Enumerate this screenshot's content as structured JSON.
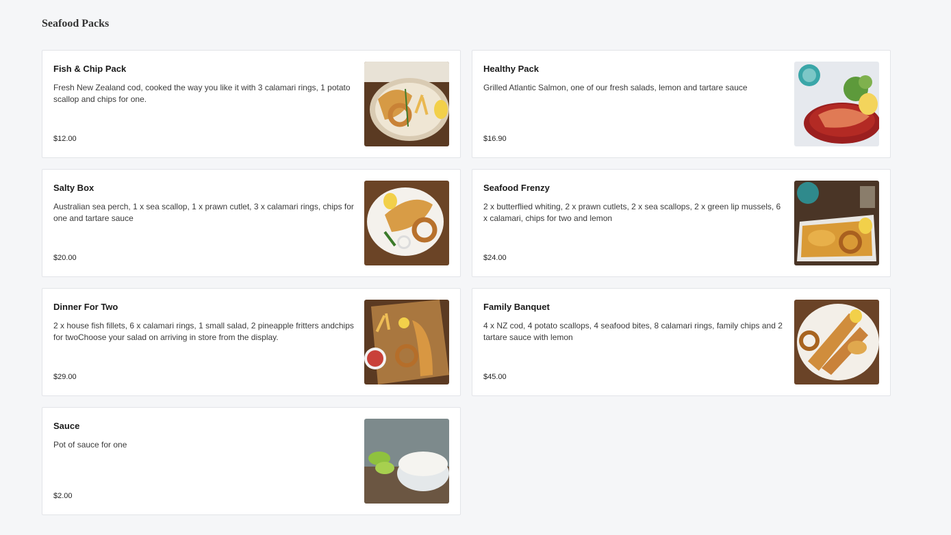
{
  "section": {
    "title": "Seafood Packs"
  },
  "items": [
    {
      "name": "Fish & Chip Pack",
      "description": "Fresh New Zealand cod, cooked the way you like it with 3 calamari rings, 1 potato scallop and chips for one.",
      "price": "$12.00",
      "image": "fish-and-chips"
    },
    {
      "name": "Healthy Pack",
      "description": "Grilled Atlantic Salmon, one of our fresh salads, lemon and tartare sauce",
      "price": "$16.90",
      "image": "salmon-salad"
    },
    {
      "name": "Salty Box",
      "description": "Australian sea perch, 1 x sea scallop, 1 x prawn cutlet, 3 x calamari rings, chips for one and tartare sauce",
      "price": "$20.00",
      "image": "fish-and-chips-plate"
    },
    {
      "name": "Seafood Frenzy",
      "description": "2 x butterflied whiting, 2 x prawn cutlets, 2 x sea scallops, 2 x green lip mussels, 6 x calamari, chips for two and lemon",
      "price": "$24.00",
      "image": "seafood-basket"
    },
    {
      "name": "Dinner For Two",
      "description": "2 x house fish fillets, 6 x calamari rings, 1 small salad, 2 pineapple fritters andchips for twoChoose your salad on arriving in store from the display.",
      "price": "$29.00",
      "image": "dinner-board"
    },
    {
      "name": "Family Banquet",
      "description": "4 x NZ cod, 4 potato scallops, 4 seafood bites, 8 calamari rings, family chips and 2 tartare sauce with lemon",
      "price": "$45.00",
      "image": "banquet-platter"
    },
    {
      "name": "Sauce",
      "description": "Pot of sauce for one",
      "price": "$2.00",
      "image": "tartare-sauce"
    }
  ]
}
